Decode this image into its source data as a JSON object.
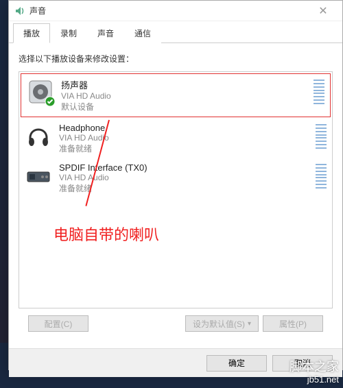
{
  "titlebar": {
    "title": "声音"
  },
  "tabs": [
    {
      "label": "播放",
      "active": true
    },
    {
      "label": "录制",
      "active": false
    },
    {
      "label": "声音",
      "active": false
    },
    {
      "label": "通信",
      "active": false
    }
  ],
  "instruction": "选择以下播放设备来修改设置：",
  "devices": [
    {
      "name": "扬声器",
      "driver": "VIA HD Audio",
      "status": "默认设备",
      "default": true,
      "highlighted": true,
      "icon": "speaker"
    },
    {
      "name": "Headphone",
      "driver": "VIA HD Audio",
      "status": "准备就绪",
      "default": false,
      "highlighted": false,
      "icon": "headphone"
    },
    {
      "name": "SPDIF Interface (TX0)",
      "driver": "VIA HD Audio",
      "status": "准备就绪",
      "default": false,
      "highlighted": false,
      "icon": "spdif"
    }
  ],
  "annotation": {
    "text": "电脑自带的喇叭"
  },
  "buttons": {
    "configure": "配置(C)",
    "set_default": "设为默认值(S)",
    "properties": "属性(P)",
    "ok": "确定",
    "cancel": "取消"
  },
  "watermark": {
    "cn": "脚本之家",
    "url": "jb51.net"
  }
}
